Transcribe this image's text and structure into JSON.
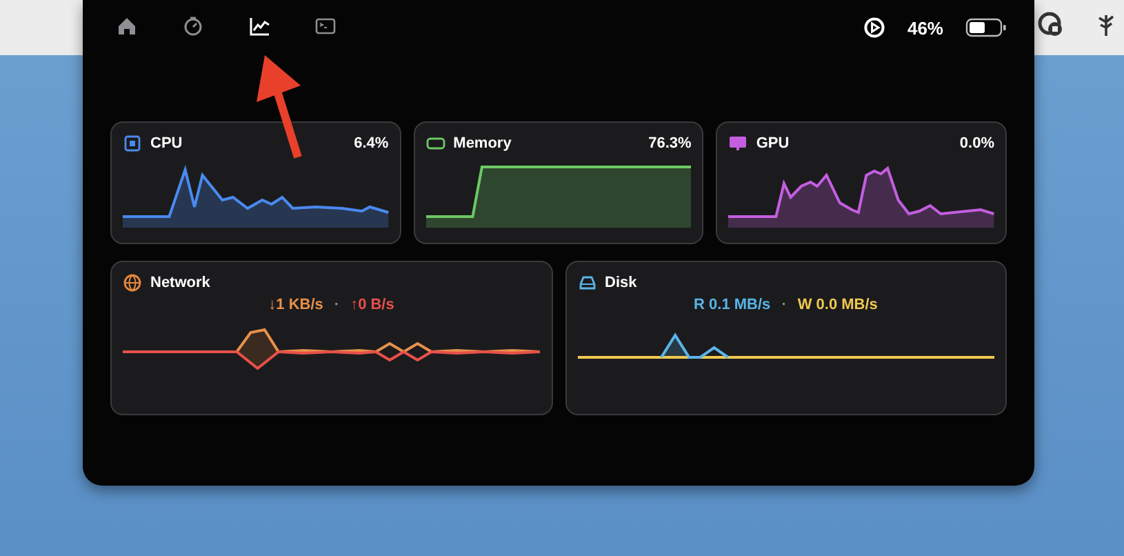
{
  "toolbar": {
    "tabs": [
      {
        "kind": "home",
        "selected": false
      },
      {
        "kind": "timer",
        "selected": false
      },
      {
        "kind": "chart",
        "selected": true
      },
      {
        "kind": "terminal",
        "selected": false
      }
    ],
    "battery_percent": "46%"
  },
  "cards": [
    {
      "kind": "cpu",
      "title": "CPU",
      "value": "6.4%",
      "color": "#4a8af0"
    },
    {
      "kind": "memory",
      "title": "Memory",
      "value": "76.3%",
      "color": "#6cc864"
    },
    {
      "kind": "gpu",
      "title": "GPU",
      "value": "0.0%",
      "color": "#c45ee0"
    }
  ],
  "io_cards": [
    {
      "kind": "network",
      "title": "Network",
      "color": "#e8883a",
      "separator": "·",
      "readings": [
        {
          "text": "↓1 KB/s",
          "color": "#e8904a"
        },
        {
          "text": "↑0 B/s",
          "color": "#e8504a"
        }
      ]
    },
    {
      "kind": "disk",
      "title": "Disk",
      "color": "#5ab4e8",
      "separator": "·",
      "readings": [
        {
          "text": "R 0.1 MB/s",
          "color": "#5ab4e8"
        },
        {
          "text": "W 0.0 MB/s",
          "color": "#f0c850"
        }
      ]
    }
  ]
}
